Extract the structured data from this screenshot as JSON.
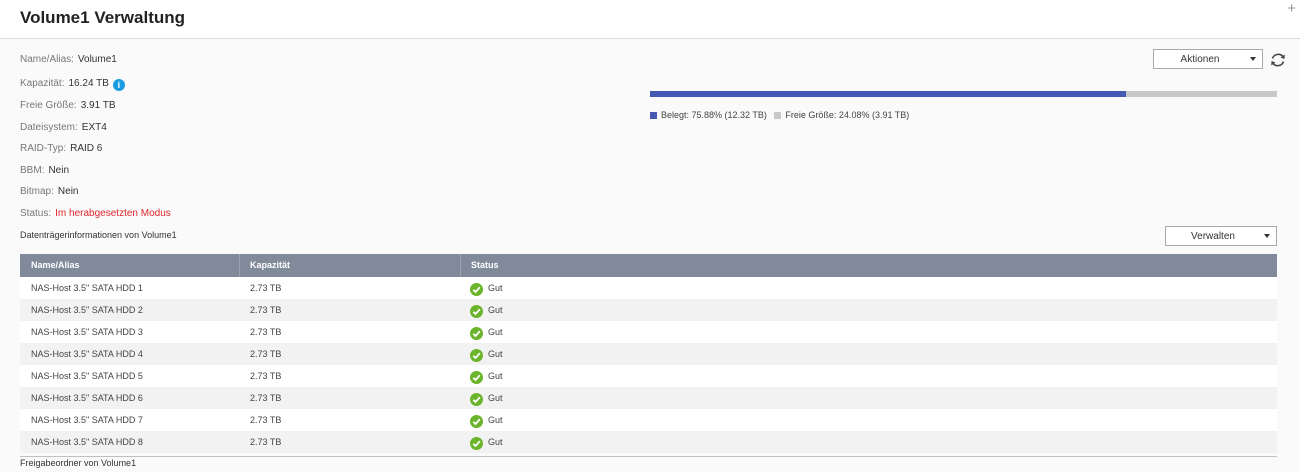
{
  "header": {
    "title": "Volume1  Verwaltung",
    "plus": "+"
  },
  "info": {
    "name": {
      "label": "Name/Alias:",
      "value": "Volume1"
    },
    "capacity": {
      "label": "Kapazität:",
      "value": "16.24 TB",
      "icon": "info-icon"
    },
    "free": {
      "label": "Freie Größe:",
      "value": "3.91 TB"
    },
    "filesystem": {
      "label": "Dateisystem:",
      "value": "EXT4"
    },
    "raid": {
      "label": "RAID-Typ:",
      "value": "RAID 6"
    },
    "bbm": {
      "label": "BBM:",
      "value": "Nein"
    },
    "bitmap": {
      "label": "Bitmap:",
      "value": "Nein"
    },
    "status": {
      "label": "Status:",
      "value": "Im herabgesetzten Modus",
      "color": "#e0262d"
    }
  },
  "actions": {
    "label": "Aktionen"
  },
  "usage": {
    "used_fraction": 0.7588,
    "used_label": "Belegt: 75.88% (12.32 TB)",
    "free_label": "Freie Größe: 24.08% (3.91 TB)",
    "used_color": "#4659b5",
    "free_color": "#c8c8c8"
  },
  "disks": {
    "section_title": "Datenträgerinformationen von Volume1",
    "manage_label": "Verwalten",
    "columns": [
      "Name/Alias",
      "Kapazität",
      "Status"
    ],
    "rows": [
      {
        "name": "NAS-Host 3.5\" SATA HDD 1",
        "capacity": "2.73 TB",
        "status": "Gut"
      },
      {
        "name": "NAS-Host 3.5\" SATA HDD 2",
        "capacity": "2.73 TB",
        "status": "Gut"
      },
      {
        "name": "NAS-Host 3.5\" SATA HDD 3",
        "capacity": "2.73 TB",
        "status": "Gut"
      },
      {
        "name": "NAS-Host 3.5\" SATA HDD 4",
        "capacity": "2.73 TB",
        "status": "Gut"
      },
      {
        "name": "NAS-Host 3.5\" SATA HDD 5",
        "capacity": "2.73 TB",
        "status": "Gut"
      },
      {
        "name": "NAS-Host 3.5\" SATA HDD 6",
        "capacity": "2.73 TB",
        "status": "Gut"
      },
      {
        "name": "NAS-Host 3.5\" SATA HDD 7",
        "capacity": "2.73 TB",
        "status": "Gut"
      },
      {
        "name": "NAS-Host 3.5\" SATA HDD 8",
        "capacity": "2.73 TB",
        "status": "Gut"
      }
    ]
  },
  "shared_folders": {
    "title": "Freigabeordner von Volume1"
  }
}
